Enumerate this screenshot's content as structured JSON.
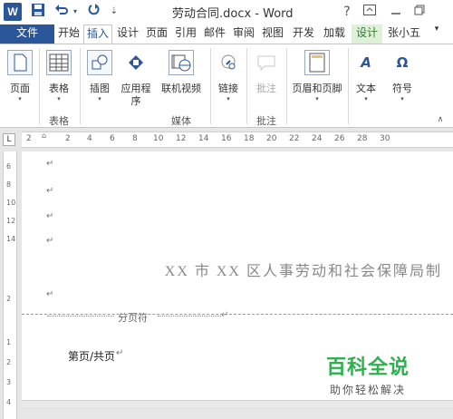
{
  "title_bar": {
    "app_icon": "W",
    "title": "劳动合同.docx - Word",
    "help": "?",
    "icons": [
      "word-app-icon",
      "save-icon",
      "undo-icon",
      "undo-dropdown-icon",
      "redo-icon",
      "customize-qat-icon",
      "help-icon",
      "ribbon-display-options-icon",
      "minimize-icon",
      "restore-icon"
    ]
  },
  "tabs": {
    "file": "文件",
    "items": [
      "开始",
      "插入",
      "设计",
      "页面",
      "引用",
      "邮件",
      "审阅",
      "视图",
      "开发",
      "加载",
      "设计",
      "张小五"
    ],
    "active": "插入",
    "contextual_tab_color": "#dff0d8"
  },
  "ribbon": {
    "buttons": [
      {
        "label": "页面",
        "icon": "page-icon"
      },
      {
        "label": "表格",
        "icon": "table-icon"
      },
      {
        "label": "插图",
        "icon": "illustrations-icon"
      },
      {
        "label": "应用程",
        "label2": "序",
        "icon": "apps-icon"
      },
      {
        "label": "联机视频",
        "icon": "online-video-icon"
      },
      {
        "label": "链接",
        "icon": "link-icon"
      },
      {
        "label": "批注",
        "icon": "comment-icon"
      },
      {
        "label": "页眉和页脚",
        "icon": "header-footer-icon"
      },
      {
        "label": "文本",
        "icon": "text-icon"
      },
      {
        "label": "符号",
        "icon": "symbol-icon"
      }
    ],
    "groups": [
      "表格",
      "媒体",
      "批注"
    ]
  },
  "ruler": {
    "corner": "L",
    "h_numbers": [
      "2",
      "2",
      "4",
      "6",
      "8",
      "10",
      "12",
      "14",
      "16",
      "18",
      "20",
      "22",
      "24",
      "26",
      "28",
      "30"
    ],
    "v_numbers": [
      "6",
      "8",
      "10",
      "12",
      "14",
      "2",
      "1",
      "2",
      "3",
      "4"
    ]
  },
  "document": {
    "para_mark": "↵",
    "header_text": "XX 市 XX 区人事劳动和社会保障局制",
    "page_break": "分页符",
    "footer_text": "第页/共页"
  },
  "watermark": {
    "title": "百科全说",
    "subtitle": "助你轻松解决",
    "color": "#2bb24c"
  },
  "colors": {
    "accent": "#2b579a"
  }
}
